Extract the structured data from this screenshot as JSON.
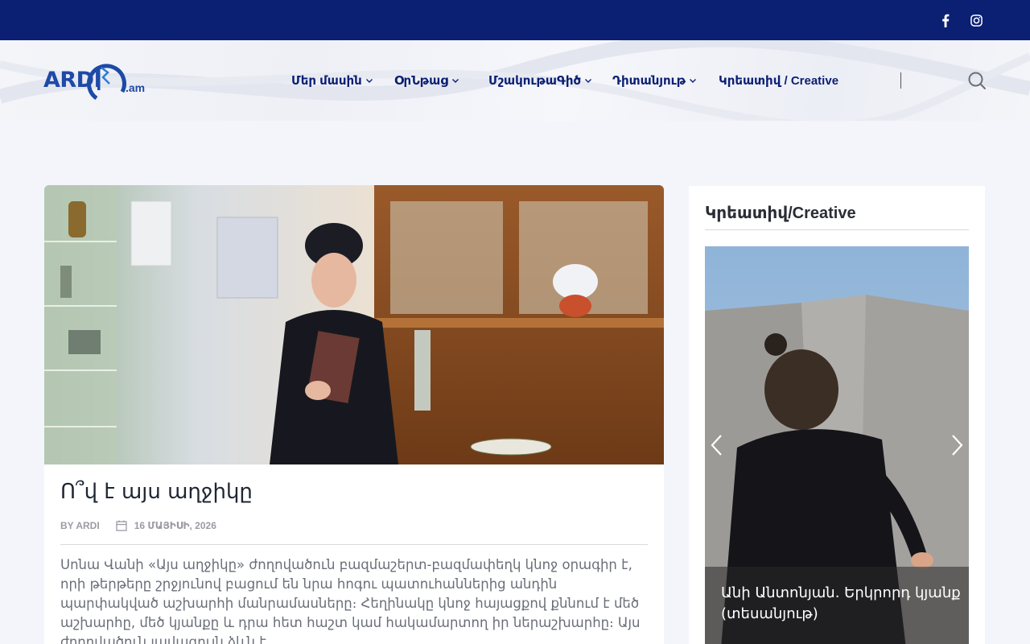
{
  "topbar": {
    "social": [
      "facebook-icon",
      "instagram-icon"
    ],
    "background": "#0b1f73"
  },
  "header": {
    "logo": {
      "text": "ARDI",
      "suffix": ".am"
    },
    "nav": [
      {
        "label": "Մեր մասին",
        "has_dropdown": true
      },
      {
        "label": "ՕրՆթաց",
        "has_dropdown": true
      },
      {
        "label": "ՄշակութաԳիծ",
        "has_dropdown": true
      },
      {
        "label": "Դիտանյութ",
        "has_dropdown": true
      },
      {
        "label": "Կրեատիվ / Creative",
        "has_dropdown": false
      }
    ],
    "search_icon": "search-icon"
  },
  "article": {
    "title": "Ո՞վ է այս աղջիկը",
    "author": "BY ARDI",
    "date": "16 ՄԱՅԻՍԻ, 2026",
    "excerpt": "Սոնա Վանի «Այս աղջիկը» ժողովածուն բազմաշերտ-բազմափեղկ կնոջ օրագիր է, որի թերթերը շրջյունով բացում են նրա հոգու պատուհաններից անդին պարփակված աշխարհի մանրամասները։ Հեղինակը կնոջ հայացքով քննում է մեծ աշխարհը, մեծ կյանքը և դրա հետ հաշտ կամ հակամարտող իր ներաշխարհը։ Այս ժողովածուն լավագույն ձևն է"
  },
  "sidebar": {
    "widget_title": "Կրեատիվ/Creative",
    "slide_caption": "Անի Անտոնյան. Երկրորդ կյանք (տեսանյութ)"
  },
  "colors": {
    "brand": "#0b1f73",
    "logo_blue": "#1d4aa6",
    "accent": "#2a7fd4"
  }
}
